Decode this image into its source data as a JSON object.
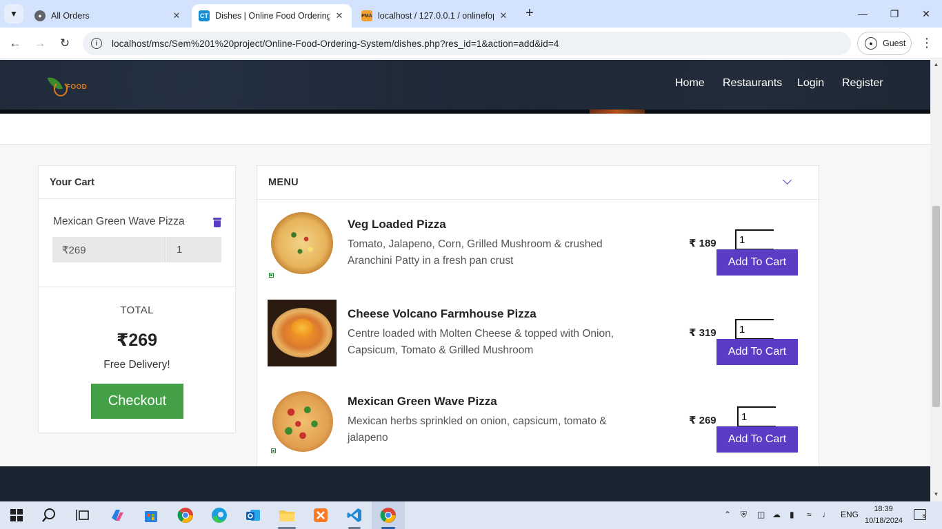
{
  "browser": {
    "tabs": [
      {
        "title": "All Orders",
        "active": false
      },
      {
        "title": "Dishes | Online Food Ordering S",
        "active": true
      },
      {
        "title": "localhost / 127.0.0.1 / onlinefop",
        "active": false
      }
    ],
    "url": "localhost/msc/Sem%201%20project/Online-Food-Ordering-System/dishes.php?res_id=1&action=add&id=4",
    "profile_label": "Guest"
  },
  "site": {
    "logo_text": "FOOD",
    "nav": [
      "Home",
      "Restaurants",
      "Login",
      "Register"
    ]
  },
  "cart": {
    "heading": "Your Cart",
    "items": [
      {
        "name": "Mexican Green Wave Pizza",
        "price": "₹269",
        "qty": "1"
      }
    ],
    "total_label": "TOTAL",
    "total_amount": "₹269",
    "delivery_note": "Free Delivery!",
    "checkout_label": "Checkout"
  },
  "menu": {
    "heading": "MENU",
    "dishes": [
      {
        "title": "Veg Loaded Pizza",
        "description": "Tomato, Jalapeno, Corn, Grilled Mushroom & crushed Aranchini Patty in a fresh pan crust",
        "price": "₹ 189",
        "qty": "1",
        "add_label": "Add To Cart"
      },
      {
        "title": "Cheese Volcano Farmhouse Pizza",
        "description": "Centre loaded with Molten Cheese & topped with Onion, Capsicum, Tomato & Grilled Mushroom",
        "price": "₹ 319",
        "qty": "1",
        "add_label": "Add To Cart"
      },
      {
        "title": "Mexican Green Wave Pizza",
        "description": "Mexican herbs sprinkled on onion, capsicum, tomato & jalapeno",
        "price": "₹ 269",
        "qty": "1",
        "add_label": "Add To Cart"
      }
    ]
  },
  "taskbar": {
    "language": "ENG",
    "time": "18:39",
    "date": "10/18/2024",
    "notification_count": "6"
  },
  "colors": {
    "accent": "#5b3cc4",
    "checkout": "#43a047",
    "header_bg": "#1a2330"
  }
}
